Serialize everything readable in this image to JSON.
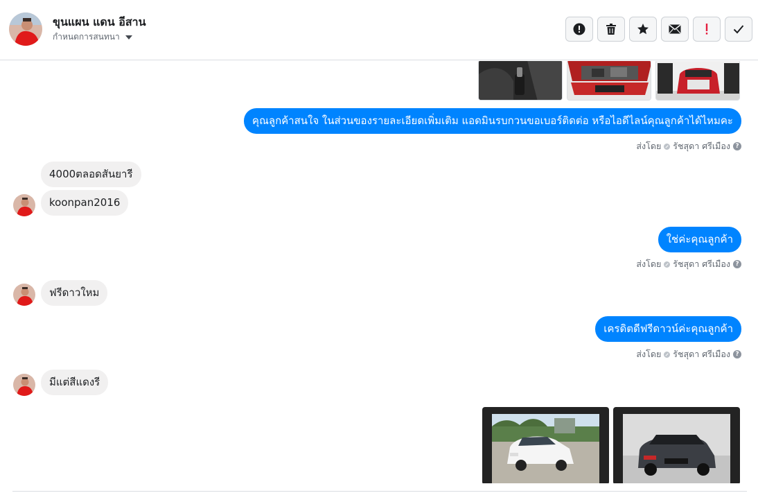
{
  "header": {
    "contact_name": "ขุนแผน แดน อีสาน",
    "subtitle": "กำหนดการสนทนา",
    "avatar_icon": "user-avatar",
    "actions": [
      {
        "name": "spam-alert-button",
        "icon": "exclamation-circle-icon"
      },
      {
        "name": "delete-button",
        "icon": "trash-icon"
      },
      {
        "name": "star-button",
        "icon": "star-icon"
      },
      {
        "name": "mark-unread-button",
        "icon": "envelope-icon"
      },
      {
        "name": "mark-important-button",
        "icon": "red-exclamation-icon"
      },
      {
        "name": "mark-done-button",
        "icon": "check-icon"
      }
    ]
  },
  "messages": {
    "out_1": "คุณลูกค้าสนใจ ในส่วนของรายละเอียดเพิ่มเติม แอดมินรบกวนขอเบอร์ติดต่อ หรือไอดีไลน์คุณลูกค้าได้ไหมคะ",
    "in_1": "4000ตลอดสันยารี",
    "in_2": "koonpan2016",
    "out_2": "ใช่ค่ะคุณลูกค้า",
    "in_3": "ฟรีดาวใหม",
    "out_3": "เครดิตดีฟรีดาวน์ค่ะคุณลูกค้า",
    "in_4": "มีแต่สีแดงรี"
  },
  "sent_by": {
    "label": "ส่งโดย",
    "agent": "รัชสุดา ศรีเมือง",
    "help": "?"
  },
  "colors": {
    "outgoing_bubble": "#0084ff",
    "incoming_bubble": "#f1f0f0",
    "important_red": "#e41e3f"
  }
}
